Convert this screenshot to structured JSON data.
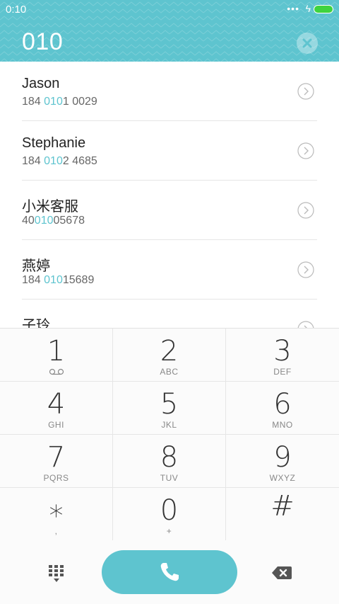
{
  "status_bar": {
    "time": "0:10",
    "signal_dots": "•••",
    "bolt": "ϟ"
  },
  "dialer": {
    "input_value": "010"
  },
  "contacts": [
    {
      "name": "Jason",
      "number_pre": "184 ",
      "number_match": "010",
      "number_post": "1 0029"
    },
    {
      "name": "Stephanie",
      "number_pre": "184 ",
      "number_match": "010",
      "number_post": "2 4685"
    },
    {
      "name": "小米客服",
      "number_pre": "40",
      "number_match": "010",
      "number_post": "05678"
    },
    {
      "name": "燕婷",
      "number_pre": "184 ",
      "number_match": "010",
      "number_post": "15689"
    },
    {
      "name": "子玲",
      "number_pre": "",
      "number_match": "",
      "number_post": ""
    }
  ],
  "keypad": [
    {
      "digit": "1",
      "letters": ""
    },
    {
      "digit": "2",
      "letters": "ABC"
    },
    {
      "digit": "3",
      "letters": "DEF"
    },
    {
      "digit": "4",
      "letters": "GHI"
    },
    {
      "digit": "5",
      "letters": "JKL"
    },
    {
      "digit": "6",
      "letters": "MNO"
    },
    {
      "digit": "7",
      "letters": "PQRS"
    },
    {
      "digit": "8",
      "letters": "TUV"
    },
    {
      "digit": "9",
      "letters": "WXYZ"
    },
    {
      "digit": "∗",
      "letters": ","
    },
    {
      "digit": "0",
      "letters": "+"
    },
    {
      "digit": "#",
      "letters": ""
    }
  ],
  "colors": {
    "accent": "#5ec4cf",
    "battery": "#3fd33f"
  },
  "icons": {
    "clear": "close-circle-icon",
    "contact_detail": "chevron-right-circle-icon",
    "voicemail": "voicemail-icon",
    "dialpad_toggle": "dialpad-icon",
    "call": "phone-icon",
    "backspace": "backspace-icon"
  }
}
